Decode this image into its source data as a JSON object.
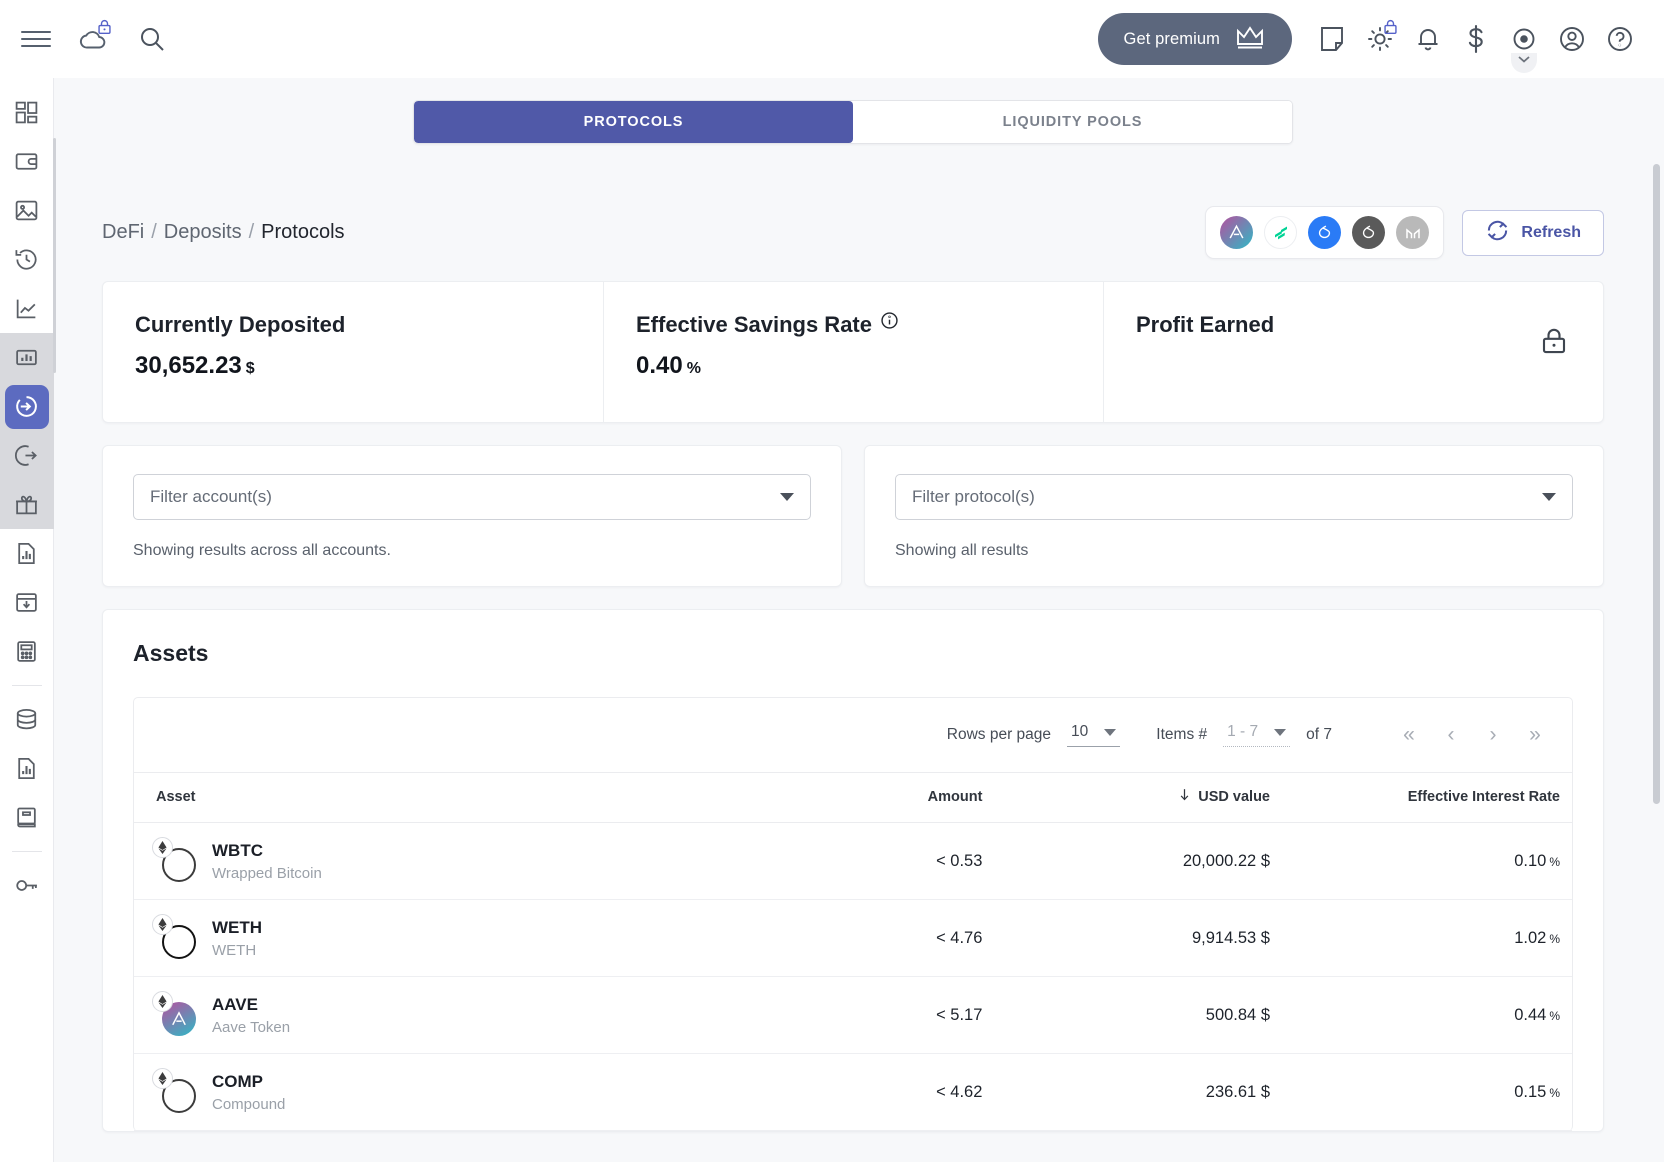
{
  "topbar": {
    "menu_icon": "hamburger-icon",
    "cloud_icon": "cloud-icon",
    "search_icon": "search-icon",
    "premium_label": "Get premium",
    "premium_icon": "crown-icon",
    "note_icon": "note-icon",
    "theme_icon": "sun-icon",
    "notifications_icon": "bell-icon",
    "currency_icon": "dollar-icon",
    "privacy_icon": "eye-icon",
    "account_icon": "user-circle-icon",
    "help_icon": "question-circle-icon"
  },
  "rail": {
    "items": [
      {
        "name": "dashboard",
        "icon": "dashboard-icon"
      },
      {
        "name": "wallet",
        "icon": "wallet-icon"
      },
      {
        "name": "nft",
        "icon": "image-icon"
      },
      {
        "name": "history",
        "icon": "history-icon"
      },
      {
        "name": "performance",
        "icon": "line-chart-icon"
      },
      {
        "name": "analytics",
        "icon": "bar-chart-box-icon"
      },
      {
        "name": "deposits",
        "icon": "arrow-into-circle-icon"
      },
      {
        "name": "withdrawals",
        "icon": "arrow-out-circle-icon"
      },
      {
        "name": "rewards",
        "icon": "gift-icon"
      },
      {
        "name": "reports",
        "icon": "document-chart-icon"
      },
      {
        "name": "import",
        "icon": "inbox-download-icon"
      },
      {
        "name": "tax",
        "icon": "calculator-icon"
      },
      {
        "name": "data",
        "icon": "database-icon"
      },
      {
        "name": "statements",
        "icon": "document-bar-icon"
      },
      {
        "name": "ledger",
        "icon": "book-icon"
      },
      {
        "name": "api-keys",
        "icon": "key-icon"
      }
    ]
  },
  "tabs": [
    {
      "label": "PROTOCOLS",
      "active": true
    },
    {
      "label": "LIQUIDITY POOLS",
      "active": false
    }
  ],
  "breadcrumb": {
    "root": "DeFi",
    "sep": "/",
    "middle": "Deposits",
    "current": "Protocols"
  },
  "protocol_chips": [
    {
      "name": "aave",
      "label": "Aave"
    },
    {
      "name": "compound",
      "label": "Compound"
    },
    {
      "name": "lido",
      "label": "Lido"
    },
    {
      "name": "lido-dark",
      "label": "Lido"
    },
    {
      "name": "maker",
      "label": "Maker"
    }
  ],
  "refresh": {
    "label": "Refresh",
    "icon": "refresh-icon"
  },
  "stats": [
    {
      "label": "Currently Deposited",
      "value": "30,652.23",
      "unit": "$",
      "info": false,
      "locked": false
    },
    {
      "label": "Effective Savings Rate",
      "value": "0.40",
      "unit": "%",
      "info": true,
      "locked": false
    },
    {
      "label": "Profit Earned",
      "value": "",
      "unit": "",
      "info": false,
      "locked": true
    }
  ],
  "filters": {
    "accounts": {
      "placeholder": "Filter account(s)",
      "note": "Showing results across all accounts."
    },
    "protocols": {
      "placeholder": "Filter protocol(s)",
      "note": "Showing all results"
    }
  },
  "assets": {
    "title": "Assets",
    "pager": {
      "rows_label": "Rows per page",
      "rows_value": "10",
      "items_label": "Items #",
      "items_value": "1 - 7",
      "of_label": "of 7",
      "first_icon": "chevrons-left-icon",
      "prev_icon": "chevron-left-icon",
      "next_icon": "chevron-right-icon",
      "last_icon": "chevrons-right-icon"
    },
    "columns": [
      "Asset",
      "Amount",
      "USD value",
      "Effective Interest Rate"
    ],
    "sorted_column": "USD value",
    "sort_direction": "desc",
    "rows": [
      {
        "symbol": "WBTC",
        "name": "Wrapped Bitcoin",
        "chain": "ethereum",
        "amount": "< 0.53",
        "usd": "20,000.22 $",
        "rate": "0.10",
        "rate_unit": "%"
      },
      {
        "symbol": "WETH",
        "name": "WETH",
        "chain": "ethereum",
        "amount": "< 4.76",
        "usd": "9,914.53 $",
        "rate": "1.02",
        "rate_unit": "%"
      },
      {
        "symbol": "AAVE",
        "name": "Aave Token",
        "chain": "ethereum",
        "amount": "< 5.17",
        "usd": "500.84 $",
        "rate": "0.44",
        "rate_unit": "%"
      },
      {
        "symbol": "COMP",
        "name": "Compound",
        "chain": "ethereum",
        "amount": "< 4.62",
        "usd": "236.61 $",
        "rate": "0.15",
        "rate_unit": "%"
      }
    ]
  },
  "colors": {
    "accent": "#5059a8",
    "rail_active": "#5c6bc0",
    "premium_bg": "#5c677d",
    "page_bg": "#f7f8fa"
  }
}
